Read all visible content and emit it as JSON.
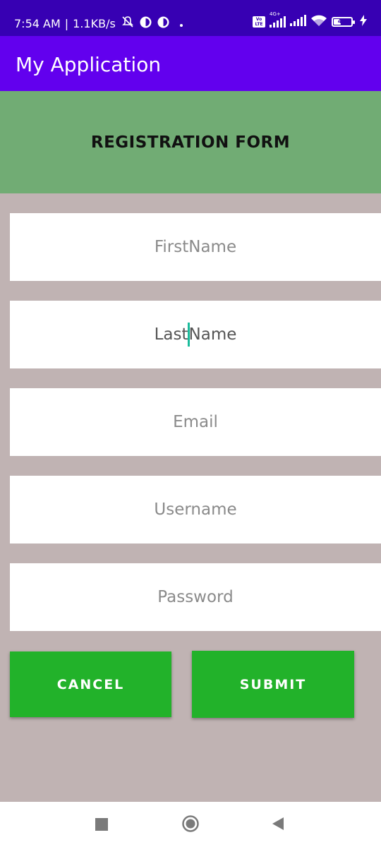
{
  "status_bar": {
    "time": "7:54 AM",
    "separator": "|",
    "net_speed": "1.1KB/s",
    "volte_label": "Vo LTE",
    "network_type": "4G+",
    "battery_percent": 0.43,
    "battery_text": "43",
    "icons": [
      "mute-icon",
      "notification-icon",
      "notification-icon",
      "dot-icon",
      "volte-icon",
      "signal-icon",
      "signal-icon",
      "wifi-icon",
      "battery-icon",
      "charging-icon"
    ]
  },
  "app_bar": {
    "title": "My Application"
  },
  "form": {
    "header_title": "REGISTRATION FORM",
    "fields": [
      {
        "placeholder": "FirstName"
      },
      {
        "value_before_cursor": "Last",
        "value_after_cursor": "Name"
      },
      {
        "placeholder": "Email"
      },
      {
        "placeholder": "Username"
      },
      {
        "placeholder": "Password"
      }
    ],
    "cancel_label": "CANCEL",
    "submit_label": "SUBMIT"
  },
  "colors": {
    "status_bar": "#3700b3",
    "app_bar": "#6200ee",
    "header_bg": "#71ac74",
    "page_bg": "#c0b3b3",
    "button_bg": "#22b22a",
    "cursor": "#1abc9c"
  },
  "nav_bar": {
    "icons": [
      "recents-square-icon",
      "home-circle-icon",
      "back-triangle-icon"
    ]
  }
}
